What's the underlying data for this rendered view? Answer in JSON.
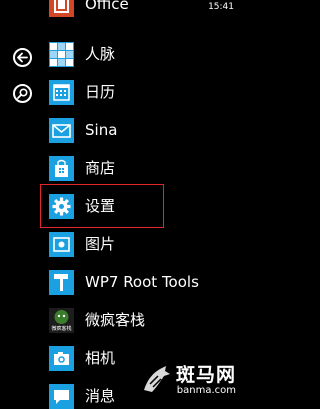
{
  "status": {
    "time": "15:41"
  },
  "side_buttons": [
    {
      "name": "back-arrow-icon"
    },
    {
      "name": "search-icon"
    }
  ],
  "apps": [
    {
      "label": "Office",
      "icon": "office-icon",
      "tile_color": "#000000"
    },
    {
      "label": "人脉",
      "icon": "people-icon",
      "tile_color": "#1ba1e2"
    },
    {
      "label": "日历",
      "icon": "calendar-icon",
      "tile_color": "#1ba1e2"
    },
    {
      "label": "Sina",
      "icon": "mail-icon",
      "tile_color": "#1ba1e2"
    },
    {
      "label": "商店",
      "icon": "store-icon",
      "tile_color": "#1ba1e2"
    },
    {
      "label": "设置",
      "icon": "gear-icon",
      "tile_color": "#1ba1e2"
    },
    {
      "label": "图片",
      "icon": "picture-icon",
      "tile_color": "#1ba1e2"
    },
    {
      "label": "WP7 Root Tools",
      "icon": "hammer-icon",
      "tile_color": "#1ba1e2"
    },
    {
      "label": "微疯客栈",
      "icon": "weifeng-kezhan-icon",
      "tile_color": "#1d1d1d",
      "icon_text": "微疯客栈"
    },
    {
      "label": "相机",
      "icon": "camera-icon",
      "tile_color": "#1ba1e2"
    },
    {
      "label": "消息",
      "icon": "message-icon",
      "tile_color": "#1ba1e2"
    }
  ],
  "highlighted_app": "设置",
  "watermark": {
    "brand": "斑马网",
    "url": "banma.com"
  },
  "colors": {
    "accent": "#1ba1e2",
    "background": "#000000",
    "highlight": "#e3262d"
  }
}
